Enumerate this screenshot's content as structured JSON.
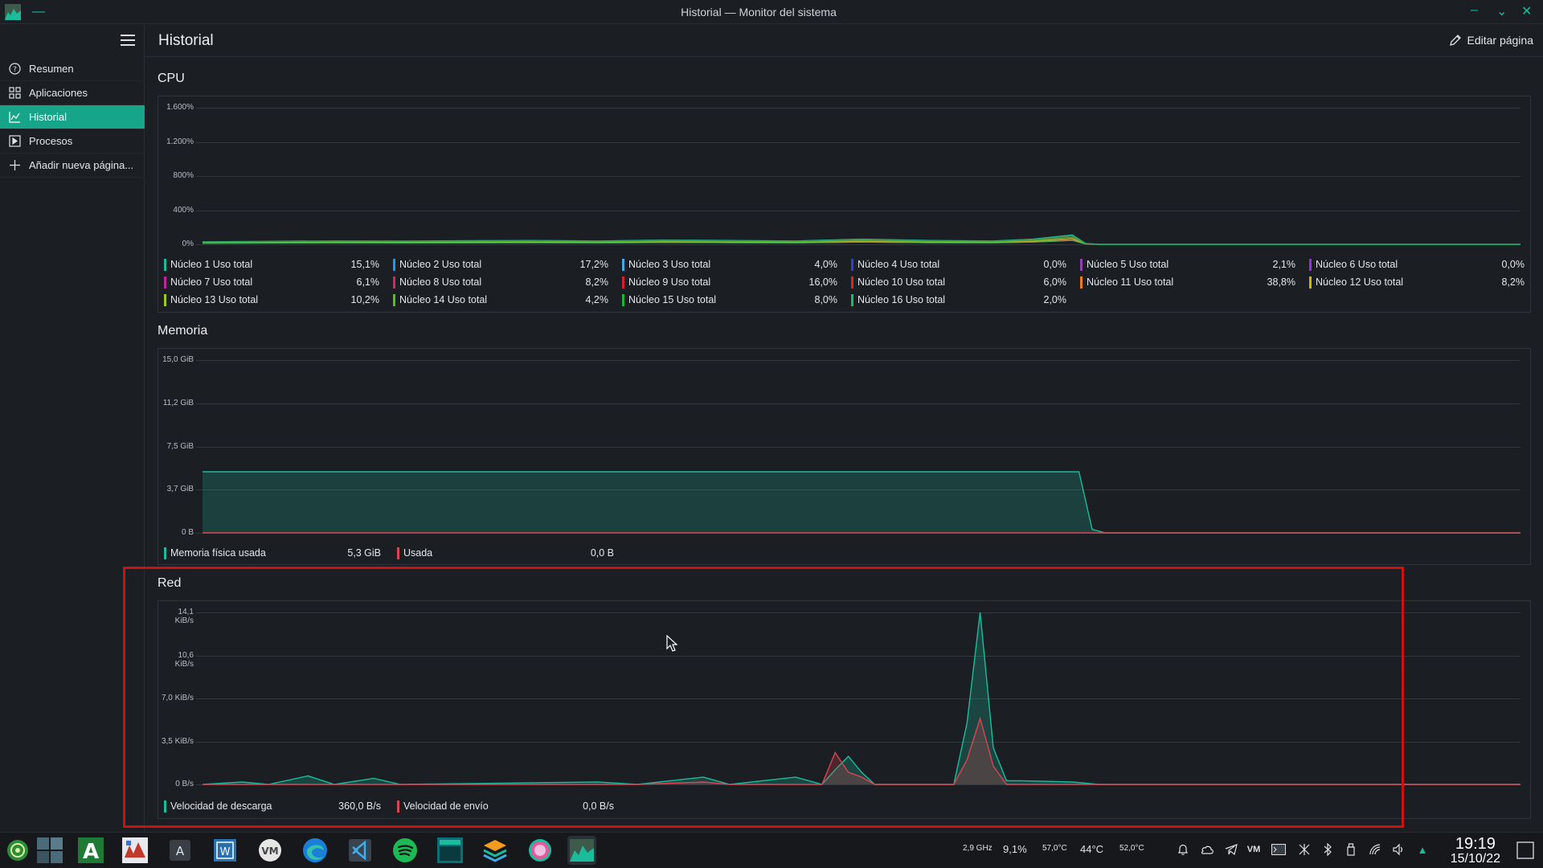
{
  "window": {
    "title": "Historial — Monitor del sistema"
  },
  "sidebar": {
    "items": [
      {
        "label": "Resumen",
        "icon": "help-circle-icon",
        "active": false
      },
      {
        "label": "Aplicaciones",
        "icon": "grid-icon",
        "active": false
      },
      {
        "label": "Historial",
        "icon": "chart-icon",
        "active": true
      },
      {
        "label": "Procesos",
        "icon": "process-icon",
        "active": false
      },
      {
        "label": "Añadir nueva página...",
        "icon": "plus-icon",
        "active": false
      }
    ]
  },
  "header": {
    "title": "Historial",
    "edit_label": "Editar página"
  },
  "cpu": {
    "title": "CPU",
    "y_ticks": [
      "1.600%",
      "1.200%",
      "800%",
      "400%",
      "0%"
    ],
    "legend": [
      {
        "name": "Núcleo 1 Uso total",
        "value": "15,1%",
        "color": "#1abc9c"
      },
      {
        "name": "Núcleo 2 Uso total",
        "value": "17,2%",
        "color": "#1d99f3"
      },
      {
        "name": "Núcleo 3 Uso total",
        "value": "4,0%",
        "color": "#3daee9"
      },
      {
        "name": "Núcleo 4 Uso total",
        "value": "0,0%",
        "color": "#2e3fd6"
      },
      {
        "name": "Núcleo 5 Uso total",
        "value": "2,1%",
        "color": "#8e44ad"
      },
      {
        "name": "Núcleo 6 Uso total",
        "value": "0,0%",
        "color": "#9b30d6"
      },
      {
        "name": "Núcleo 7 Uso total",
        "value": "6,1%",
        "color": "#c0269b"
      },
      {
        "name": "Núcleo 8 Uso total",
        "value": "8,2%",
        "color": "#d6266a"
      },
      {
        "name": "Núcleo 9 Uso total",
        "value": "16,0%",
        "color": "#da1a3a"
      },
      {
        "name": "Núcleo 10 Uso total",
        "value": "6,0%",
        "color": "#d22a1d"
      },
      {
        "name": "Núcleo 11 Uso total",
        "value": "38,8%",
        "color": "#e67e22"
      },
      {
        "name": "Núcleo 12 Uso total",
        "value": "8,2%",
        "color": "#d6b21a"
      },
      {
        "name": "Núcleo 13 Uso total",
        "value": "10,2%",
        "color": "#9ccc1a"
      },
      {
        "name": "Núcleo 14 Uso total",
        "value": "4,2%",
        "color": "#4fc41a"
      },
      {
        "name": "Núcleo 15 Uso total",
        "value": "8,0%",
        "color": "#1ab53a"
      },
      {
        "name": "Núcleo 16 Uso total",
        "value": "2,0%",
        "color": "#1abc6a"
      }
    ]
  },
  "memory": {
    "title": "Memoria",
    "y_ticks": [
      "15,0 GiB",
      "11,2 GiB",
      "7,5 GiB",
      "3,7 GiB",
      "0 B"
    ],
    "legend": [
      {
        "name": "Memoria física usada",
        "value": "5,3 GiB",
        "color": "#1abc9c"
      },
      {
        "name": "Usada",
        "value": "0,0 B",
        "color": "#da4453"
      }
    ]
  },
  "network": {
    "title": "Red",
    "y_ticks": [
      "14,1 KiB/s",
      "10,6 KiB/s",
      "7,0 KiB/s",
      "3,5 KiB/s",
      "0 B/s"
    ],
    "legend": [
      {
        "name": "Velocidad de descarga",
        "value": "360,0 B/s",
        "color": "#1abc9c"
      },
      {
        "name": "Velocidad de envío",
        "value": "0,0 B/s",
        "color": "#da4453"
      }
    ]
  },
  "chart_data": [
    {
      "type": "area",
      "title": "CPU",
      "ylim": [
        0,
        1600
      ],
      "x": [
        0,
        5,
        10,
        15,
        20,
        25,
        30,
        35,
        40,
        45,
        50,
        55,
        60,
        63,
        66,
        67,
        68,
        100
      ],
      "series": [
        {
          "name": "Núcleo 1 Uso total",
          "values": [
            30,
            35,
            40,
            38,
            42,
            45,
            40,
            50,
            45,
            40,
            60,
            45,
            40,
            60,
            110,
            10,
            0,
            0
          ]
        }
      ]
    },
    {
      "type": "area",
      "title": "Memoria",
      "ylim": [
        0,
        15.0
      ],
      "x": [
        0,
        66.5,
        67.5,
        68.5,
        100
      ],
      "series": [
        {
          "name": "Memoria física usada",
          "values": [
            5.3,
            5.3,
            0.3,
            0,
            0
          ]
        },
        {
          "name": "Usada",
          "values": [
            0,
            0,
            0,
            0,
            0
          ]
        }
      ]
    },
    {
      "type": "line",
      "title": "Red",
      "ylim": [
        0,
        14.1
      ],
      "x": [
        0,
        3,
        5,
        8,
        10,
        13,
        15,
        30,
        33,
        38,
        40,
        45,
        47,
        48,
        49,
        50,
        51,
        52,
        53,
        57,
        58,
        59,
        60,
        61,
        62,
        66,
        68,
        100
      ],
      "series": [
        {
          "name": "Velocidad de descarga",
          "values": [
            0,
            0.2,
            0,
            0.7,
            0,
            0.5,
            0,
            0.2,
            0,
            0.6,
            0,
            0.6,
            0,
            1.2,
            2.3,
            1.0,
            0,
            0,
            0,
            0,
            5.0,
            14.1,
            3.0,
            0.3,
            0.3,
            0.2,
            0,
            0
          ]
        },
        {
          "name": "Velocidad de envío",
          "values": [
            0,
            0,
            0,
            0,
            0,
            0,
            0,
            0,
            0,
            0.2,
            0,
            0,
            0,
            2.6,
            1.0,
            0.6,
            0,
            0,
            0,
            0,
            2.0,
            5.4,
            1.5,
            0,
            0,
            0,
            0,
            0
          ]
        }
      ]
    }
  ],
  "taskbar": {
    "tray": {
      "cpu_freq": "2,9 GHz",
      "cpu_load": "9,1%",
      "temp1": "57,0°C",
      "temp2": "44°C",
      "temp3": "52,0°C",
      "vm_label": "VM"
    },
    "time": "19:19",
    "date": "15/10/22"
  }
}
